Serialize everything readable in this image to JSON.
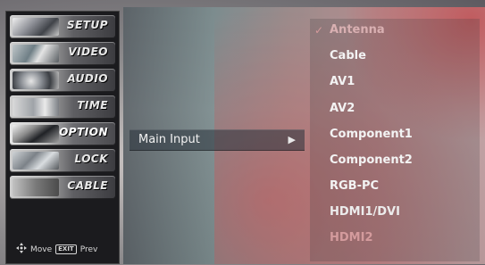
{
  "sidebar": {
    "items": [
      {
        "label": "SETUP"
      },
      {
        "label": "VIDEO"
      },
      {
        "label": "AUDIO"
      },
      {
        "label": "TIME"
      },
      {
        "label": "OPTION"
      },
      {
        "label": "LOCK"
      },
      {
        "label": "CABLE"
      }
    ],
    "hint_move": "Move",
    "hint_exit_key": "EXIT",
    "hint_prev": "Prev"
  },
  "main": {
    "selected_item": "Main Input",
    "arrow": "▶"
  },
  "options": {
    "check_mark": "✓",
    "items": [
      {
        "label": "Antenna"
      },
      {
        "label": "Cable"
      },
      {
        "label": "AV1"
      },
      {
        "label": "AV2"
      },
      {
        "label": "Component1"
      },
      {
        "label": "Component2"
      },
      {
        "label": "RGB-PC"
      },
      {
        "label": "HDMI1/DVI"
      },
      {
        "label": "HDMI2"
      }
    ]
  },
  "colors": {
    "accent_pink": "#d59a9c",
    "menu_bg": "#1b1b1e",
    "text": "#f3f3f3"
  }
}
